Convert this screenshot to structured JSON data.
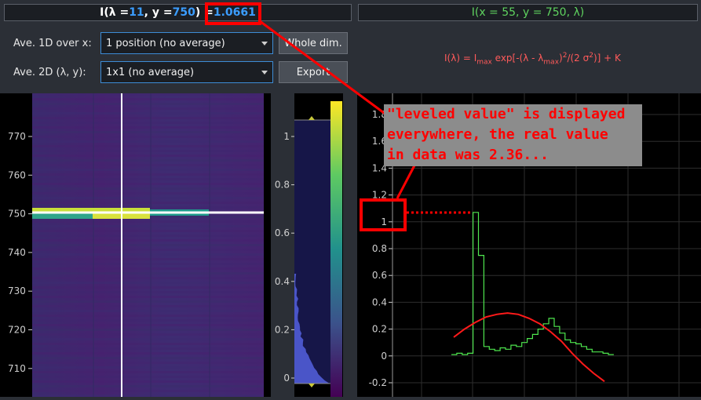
{
  "header_left": {
    "prefix": "I(λ = ",
    "lambda": "11",
    "mid": ", y = ",
    "y": "750",
    "suffix": ") = ",
    "value": "1.0661"
  },
  "header_right": {
    "title": "I(x = 55, y = 750, λ)"
  },
  "controls": {
    "ave1d_label": "Ave. 1D over x:",
    "ave1d_value": "1 position (no average)",
    "ave2d_label": "Ave. 2D (λ, y):",
    "ave2d_value": "1x1 (no average)",
    "whole_dim_label": "Whole dim.",
    "export_label": "Export"
  },
  "formula": {
    "base": "I(λ) = I",
    "sub1": "max",
    "mid": " exp[-(λ - λ",
    "sub2": "max",
    "mid2": ")",
    "sup": "2",
    "end": "/(2 σ",
    "sup2": "2",
    "tail": ")] + K"
  },
  "annotation": {
    "text": "\"leveled value\" is displayed\neverywhere, the real value\nin data was 2.36..."
  },
  "image_axis": {
    "y_ticks": [
      "770",
      "760",
      "750",
      "740",
      "730",
      "720",
      "710"
    ]
  },
  "colorbar_axis": {
    "ticks": [
      "1",
      "0.8",
      "0.6",
      "0.4",
      "0.2",
      "0"
    ]
  },
  "chart_data": {
    "type": "line",
    "y_ticks": [
      "1.8",
      "1.6",
      "1.4",
      "1.2",
      "1",
      "0.8",
      "0.6",
      "0.4",
      "0.2",
      "0",
      "-0.2"
    ],
    "ylim": [
      -0.3,
      1.9
    ],
    "grid": true,
    "series": [
      {
        "color": "#4ee64e",
        "x": [
          0,
          1,
          2,
          3,
          4,
          5,
          6,
          7,
          8,
          9,
          10,
          11,
          12,
          13,
          14,
          15,
          16,
          17,
          18,
          19,
          20,
          21,
          22,
          23,
          24,
          25,
          26,
          27,
          28,
          29
        ],
        "values": [
          0.01,
          0.02,
          0.01,
          0.02,
          1.07,
          0.75,
          0.07,
          0.05,
          0.04,
          0.06,
          0.05,
          0.08,
          0.07,
          0.1,
          0.13,
          0.16,
          0.2,
          0.24,
          0.28,
          0.22,
          0.17,
          0.12,
          0.1,
          0.09,
          0.07,
          0.05,
          0.03,
          0.03,
          0.02,
          0.01
        ]
      },
      {
        "color": "#ff1a1a",
        "x": [
          0,
          2,
          4,
          6,
          8,
          10,
          12,
          14,
          16,
          18,
          20,
          22,
          24,
          26,
          28
        ],
        "values": [
          0.14,
          0.2,
          0.25,
          0.29,
          0.31,
          0.32,
          0.31,
          0.28,
          0.24,
          0.18,
          0.11,
          0.02,
          -0.06,
          -0.13,
          -0.19
        ]
      }
    ]
  }
}
